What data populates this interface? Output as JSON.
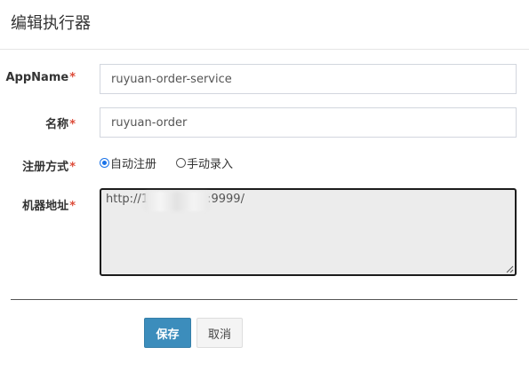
{
  "dialog": {
    "title": "编辑执行器"
  },
  "form": {
    "app_name": {
      "label": "AppName",
      "required_mark": "*",
      "value": "ruyuan-order-service"
    },
    "title": {
      "label": "名称",
      "required_mark": "*",
      "value": "ruyuan-order"
    },
    "register_type": {
      "label": "注册方式",
      "required_mark": "*",
      "options": [
        {
          "label": "自动注册",
          "checked": true
        },
        {
          "label": "手动录入",
          "checked": false
        }
      ]
    },
    "address": {
      "label": "机器地址",
      "required_mark": "*",
      "prefix": "http://1",
      "suffix": ":9999/"
    }
  },
  "buttons": {
    "save": "保存",
    "cancel": "取消"
  },
  "colors": {
    "primary": "#3c8dbc",
    "required": "#dd4b39",
    "radio_checked": "#1a73e8"
  }
}
